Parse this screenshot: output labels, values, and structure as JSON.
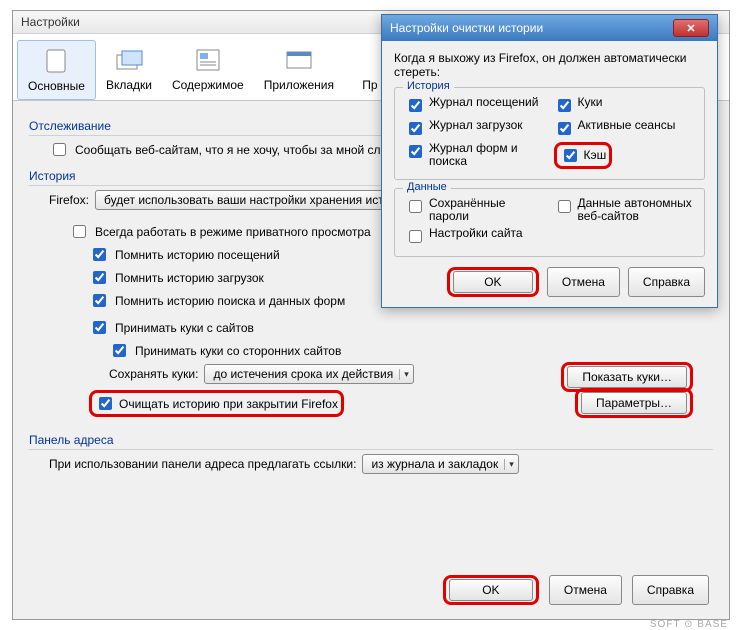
{
  "main": {
    "title": "Настройки",
    "tabs": [
      "Основные",
      "Вкладки",
      "Содержимое",
      "Приложения",
      "Пр"
    ],
    "tracking": {
      "label": "Отслеживание",
      "tell_sites": "Сообщать веб-сайтам, что я не хочу, чтобы за мной след"
    },
    "history": {
      "label": "История",
      "firefox_label": "Firefox:",
      "mode": "будет использовать ваши настройки хранения истор",
      "always_private": "Всегда работать в режиме приватного просмотра",
      "remember_visits": "Помнить историю посещений",
      "remember_downloads": "Помнить историю загрузок",
      "remember_forms": "Помнить историю поиска и данных форм",
      "accept_cookies": "Принимать куки с сайтов",
      "accept_third": "Принимать куки со сторонних сайтов",
      "keep_cookies_label": "Сохранять куки:",
      "keep_cookies_value": "до истечения срока их действия",
      "show_cookies": "Показать куки…",
      "clear_on_close": "Очищать историю при закрытии Firefox",
      "params_btn": "Параметры…"
    },
    "addressbar": {
      "label": "Панель адреса",
      "suggest_label": "При использовании панели адреса предлагать ссылки:",
      "suggest_value": "из журнала и закладок"
    },
    "buttons": {
      "ok": "OK",
      "cancel": "Отмена",
      "help": "Справка"
    }
  },
  "dialog": {
    "title": "Настройки очистки истории",
    "intro": "Когда я выхожу из Firefox, он должен автоматически стереть:",
    "history_group": "История",
    "data_group": "Данные",
    "items": {
      "visits": "Журнал посещений",
      "downloads": "Журнал загрузок",
      "forms": "Журнал форм и поиска",
      "cookies": "Куки",
      "sessions": "Активные сеансы",
      "cache": "Кэш",
      "passwords": "Сохранённые пароли",
      "offline": "Данные автономных веб-сайтов",
      "site_prefs": "Настройки сайта"
    },
    "buttons": {
      "ok": "OK",
      "cancel": "Отмена",
      "help": "Справка"
    }
  },
  "watermark": "SOFT ⊙ BASE"
}
